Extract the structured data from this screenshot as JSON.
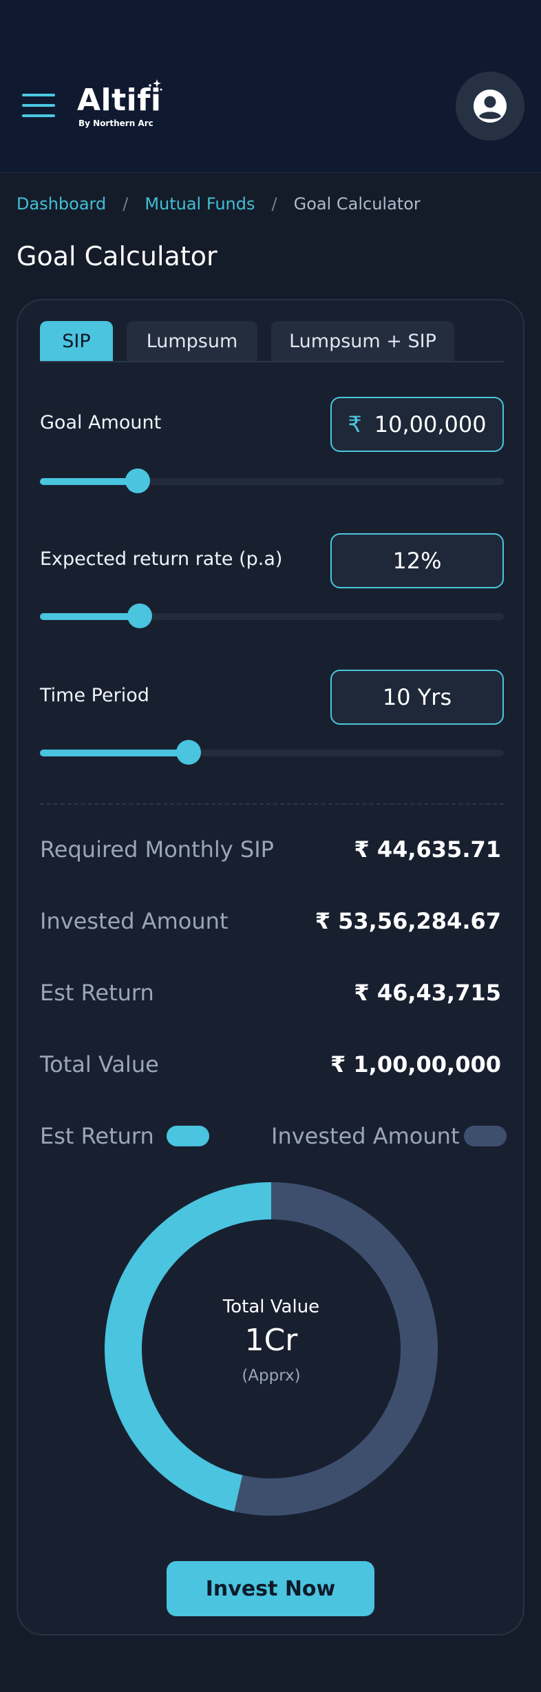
{
  "header": {
    "logo_text": "Altifi",
    "logo_subtext": "By Northern Arc",
    "menu_icon": "hamburger-menu-icon",
    "profile_icon": "user-circle-icon"
  },
  "breadcrumb": {
    "items": [
      "Dashboard",
      "Mutual Funds",
      "Goal Calculator"
    ],
    "separator": "/"
  },
  "page_title": "Goal Calculator",
  "tabs": [
    {
      "label": "SIP",
      "active": true
    },
    {
      "label": "Lumpsum",
      "active": false
    },
    {
      "label": "Lumpsum + SIP",
      "active": false
    }
  ],
  "inputs": {
    "goal_amount": {
      "label": "Goal Amount",
      "currency": "₹",
      "value": "10,00,000",
      "slider_fraction": 0.21
    },
    "return_rate": {
      "label": "Expected return rate (p.a)",
      "value": "12%",
      "slider_fraction": 0.215
    },
    "time_period": {
      "label": "Time Period",
      "value": "10 Yrs",
      "slider_fraction": 0.32
    }
  },
  "results": [
    {
      "label": "Required Monthly SIP",
      "value": "₹ 44,635.71"
    },
    {
      "label": "Invested Amount",
      "value": "₹ 53,56,284.67"
    },
    {
      "label": "Est Return",
      "value": "₹ 46,43,715"
    },
    {
      "label": "Total Value",
      "value": "₹ 1,00,00,000"
    }
  ],
  "legend": {
    "est_return": {
      "label": "Est Return",
      "color": "#4ac4df"
    },
    "invested": {
      "label": "Invested Amount",
      "color": "#3e4f6e"
    }
  },
  "donut": {
    "title": "Total Value",
    "value": "1Cr",
    "note": "(Apprx)",
    "est_return_amount": 4643715,
    "invested_amount": 5356284.67
  },
  "colors": {
    "accent": "#4ac4df",
    "invested": "#3e4f6e",
    "background": "#151c29",
    "card": "#182030"
  },
  "cta": {
    "label": "Invest Now"
  }
}
